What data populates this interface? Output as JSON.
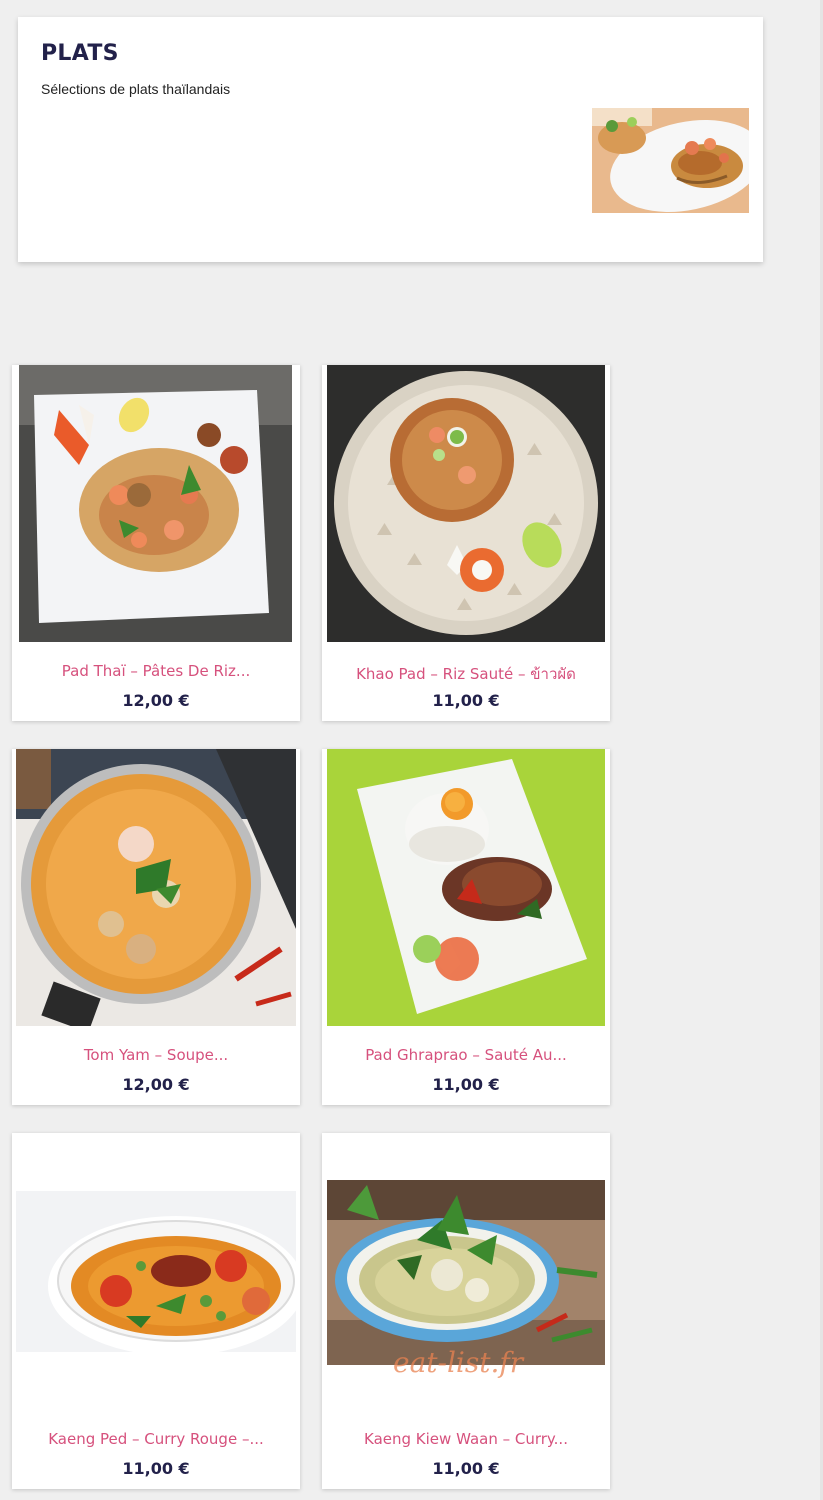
{
  "header": {
    "title": "PLATS",
    "subtitle": "Sélections de plats thaïlandais",
    "image_icon": "pad-thai-photo"
  },
  "products": [
    {
      "name": "Pad Thaï – Pâtes De Riz...",
      "price": "12,00 €",
      "image_icon": "pad-thai-photo"
    },
    {
      "name": "Khao Pad – Riz Sauté – ข้าวผัด",
      "price": "11,00 €",
      "image_icon": "fried-rice-photo"
    },
    {
      "name": "Tom Yam – Soupe...",
      "price": "12,00 €",
      "image_icon": "tom-yam-soup-photo"
    },
    {
      "name": "Pad Ghraprao – Sauté Au...",
      "price": "11,00 €",
      "image_icon": "basil-stir-fry-photo"
    },
    {
      "name": "Kaeng Ped – Curry Rouge –...",
      "price": "11,00 €",
      "image_icon": "red-curry-photo"
    },
    {
      "name": "Kaeng Kiew Waan – Curry...",
      "price": "11,00 €",
      "image_icon": "green-curry-photo"
    }
  ],
  "watermark": "eat-list.fr"
}
